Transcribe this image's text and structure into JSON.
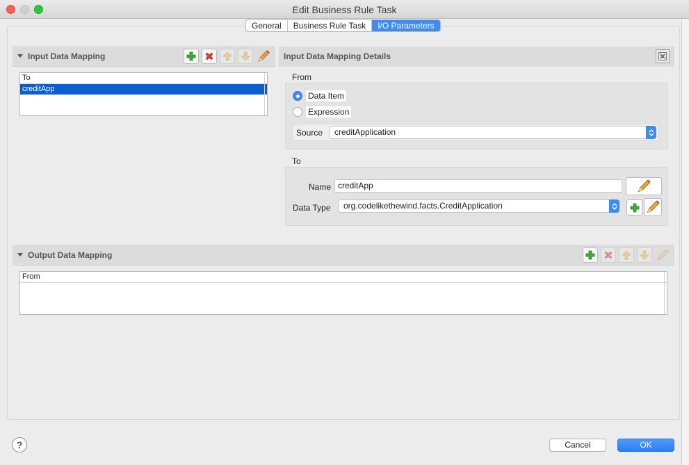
{
  "window": {
    "title": "Edit Business Rule Task"
  },
  "tabs": [
    {
      "label": "General",
      "active": false
    },
    {
      "label": "Business Rule Task",
      "active": false
    },
    {
      "label": "I/O Parameters",
      "active": true
    }
  ],
  "input_mapping": {
    "title": "Input Data Mapping",
    "columns": [
      "To"
    ],
    "rows": [
      "creditApp"
    ],
    "selected_row": 0,
    "toolbar": [
      "add-icon",
      "remove-icon",
      "move-up-icon",
      "move-down-icon",
      "edit-icon"
    ]
  },
  "details": {
    "title": "Input Data Mapping Details",
    "from": {
      "label": "From",
      "options": [
        {
          "label": "Data Item",
          "checked": true
        },
        {
          "label": "Expression",
          "checked": false
        }
      ],
      "source_label": "Source",
      "source_value": "creditApplication"
    },
    "to": {
      "label": "To",
      "name_label": "Name",
      "name_value": "creditApp",
      "data_type_label": "Data Type",
      "data_type_value": "org.codelikethewind.facts.CreditApplication"
    }
  },
  "output_mapping": {
    "title": "Output Data Mapping",
    "columns": [
      "From"
    ],
    "toolbar": [
      "add-icon",
      "remove-icon",
      "move-up-icon",
      "move-down-icon",
      "edit-icon"
    ]
  },
  "footer": {
    "help": "?",
    "cancel": "Cancel",
    "ok": "OK"
  },
  "colors": {
    "accent": "#3d8bf5",
    "selection": "#0a5fd4"
  }
}
